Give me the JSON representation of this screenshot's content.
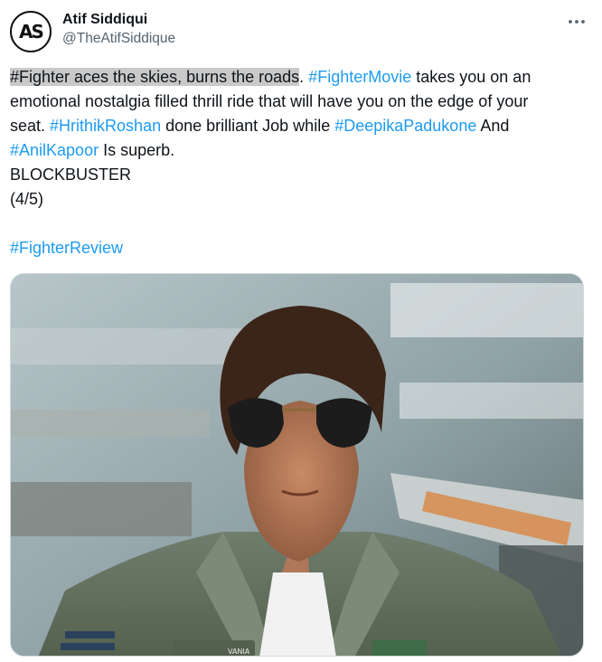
{
  "user": {
    "avatar_text": "AS",
    "display_name": "Atif Siddiqui",
    "handle": "@TheAtifSiddique"
  },
  "more_icon": "more-horizontal-icon",
  "post": {
    "line1": {
      "highlighted": "#Fighter aces the skies, burns the roads",
      "after_highlight": ". ",
      "tag": "#FighterMovie",
      "rest": " takes you on an"
    },
    "line2": "emotional nostalgia filled thrill ride that will have you on the edge of your",
    "line3": {
      "pre": "seat. ",
      "tag1": "#HrithikRoshan",
      "mid": " done brilliant Job while ",
      "tag2": "#DeepikaPadukone",
      "post": " And"
    },
    "line4": {
      "tag": "#AnilKapoor",
      "rest": " Is superb."
    },
    "line5": "BLOCKBUSTER",
    "line6": "(4/5)",
    "review_tag": "#FighterReview"
  },
  "media": {
    "type": "photo",
    "description_icon": "photo-man-aviator-sunglasses",
    "badge_text": "VANIA"
  },
  "colors": {
    "link": "#1d9bf0",
    "text": "#0f1419",
    "secondary": "#536471",
    "highlight": "#c9c9c9"
  }
}
